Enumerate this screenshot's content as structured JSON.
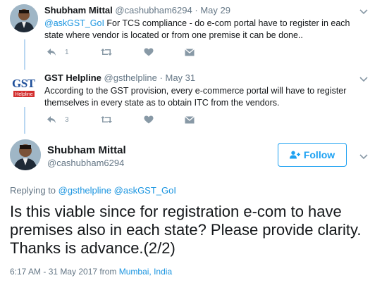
{
  "tweet1": {
    "name": "Shubham Mittal",
    "handle": "@cashubham6294",
    "dot": "·",
    "date": "May 29",
    "mention": "@askGST_GoI",
    "text": " For TCS compliance - do e-com portal have to register in each state where vendor is located or from one premise it can be done..",
    "reply_count": "1"
  },
  "tweet2": {
    "name": "GST Helpline",
    "handle": "@gsthelpline",
    "dot": "·",
    "date": "May 31",
    "text": "According to the GST provision, every e-commerce portal will have to register themselves in every state as to obtain ITC from the vendors.",
    "reply_count": "3",
    "logo_text": "GST",
    "logo_sub": "Helpline"
  },
  "main": {
    "name": "Shubham Mittal",
    "handle": "@cashubham6294",
    "follow_label": "Follow",
    "replying_prefix": "Replying to ",
    "replying_to_1": "@gsthelpline",
    "replying_to_2": "@askGST_GoI",
    "text": "Is this viable since for registration e-com to have premises also in each state? Please provide clarity. Thanks is advance.(2/2)",
    "timestamp": "6:17 AM - 31 May 2017 from ",
    "location": "Mumbai, India"
  },
  "icons": [
    "reply-icon",
    "retweet-icon",
    "like-icon",
    "message-icon",
    "chevron-down-icon",
    "follow-person-icon"
  ],
  "colors": {
    "accent": "#1da1f2",
    "link": "#1b95e0",
    "muted": "#657786",
    "thread": "#b9d7f1"
  }
}
